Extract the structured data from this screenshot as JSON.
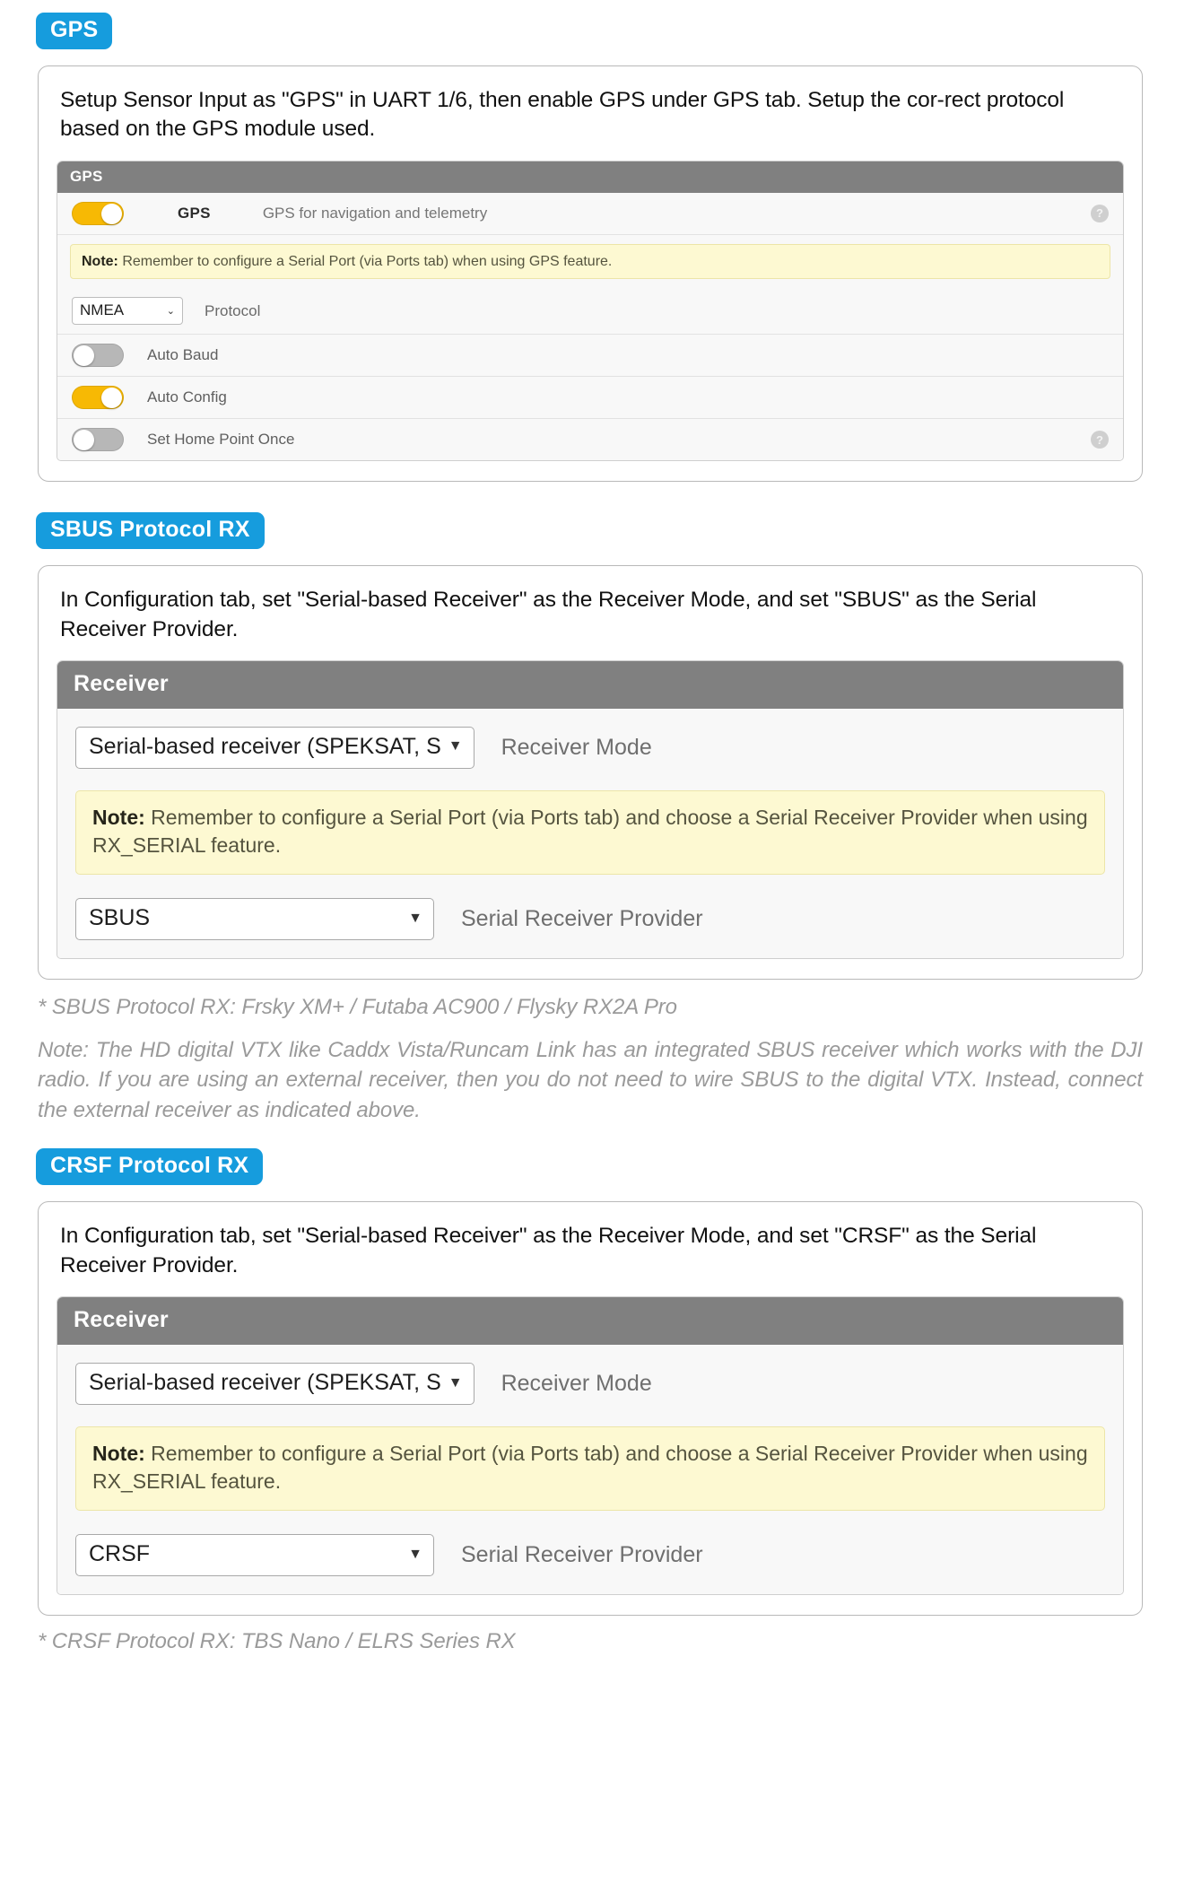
{
  "sections": [
    {
      "badge": "GPS",
      "intro": "Setup Sensor Input as \"GPS\" in UART 1/6, then enable GPS under GPS tab. Setup the cor-rect protocol based on the GPS module used.",
      "panel": {
        "header": "GPS",
        "toggle_name": "GPS",
        "toggle_desc": "GPS for navigation and telemetry",
        "note_label": "Note:",
        "note_text": " Remember to configure a Serial Port (via Ports tab) when using GPS feature.",
        "protocol_value": "NMEA",
        "protocol_label": "Protocol",
        "rows": [
          {
            "label": "Auto Baud",
            "state": "off",
            "help": false
          },
          {
            "label": "Auto Config",
            "state": "on",
            "help": false
          },
          {
            "label": "Set Home Point Once",
            "state": "off",
            "help": true
          }
        ],
        "help_glyph": "?"
      }
    },
    {
      "badge": "SBUS Protocol RX",
      "intro": "In Configuration tab, set \"Serial-based Receiver\" as the Receiver Mode, and set \"SBUS\" as the Serial Receiver Provider.",
      "panel": {
        "header": "Receiver",
        "mode_value": "Serial-based receiver (SPEKSAT, S",
        "mode_label": "Receiver Mode",
        "note_label": "Note:",
        "note_text": " Remember to configure a Serial Port (via Ports tab) and choose a Serial Receiver Provider when using RX_SERIAL feature.",
        "provider_value": "SBUS",
        "provider_label": "Serial Receiver Provider"
      },
      "footnotes": [
        "* SBUS Protocol RX: Frsky XM+ / Futaba AC900 / Flysky RX2A Pro",
        "Note: The HD digital VTX like Caddx Vista/Runcam Link has an integrated SBUS receiver which works with the DJI radio. If you are using an external receiver, then you do not need to wire SBUS to the digital VTX. Instead, connect the external receiver as indicated above."
      ]
    },
    {
      "badge": "CRSF Protocol RX",
      "intro": "In Configuration tab, set \"Serial-based Receiver\" as the Receiver Mode, and set \"CRSF\" as the Serial Receiver Provider.",
      "panel": {
        "header": "Receiver",
        "mode_value": "Serial-based receiver (SPEKSAT, S",
        "mode_label": "Receiver Mode",
        "note_label": "Note:",
        "note_text": " Remember to configure a Serial Port (via Ports tab) and choose a Serial Receiver Provider when using RX_SERIAL feature.",
        "provider_value": "CRSF",
        "provider_label": "Serial Receiver Provider"
      },
      "footnotes": [
        "* CRSF Protocol RX: TBS Nano / ELRS Series RX"
      ]
    }
  ],
  "icons": {
    "caret_down": "▼",
    "caret_down_thin": "⌄",
    "help": "?"
  },
  "colors": {
    "badge_blue": "#169cdd",
    "panel_header_gray": "#808080",
    "toggle_on_yellow": "#f7b904",
    "toggle_off_gray": "#b7b7b7",
    "note_yellow": "#fdf9d2"
  }
}
